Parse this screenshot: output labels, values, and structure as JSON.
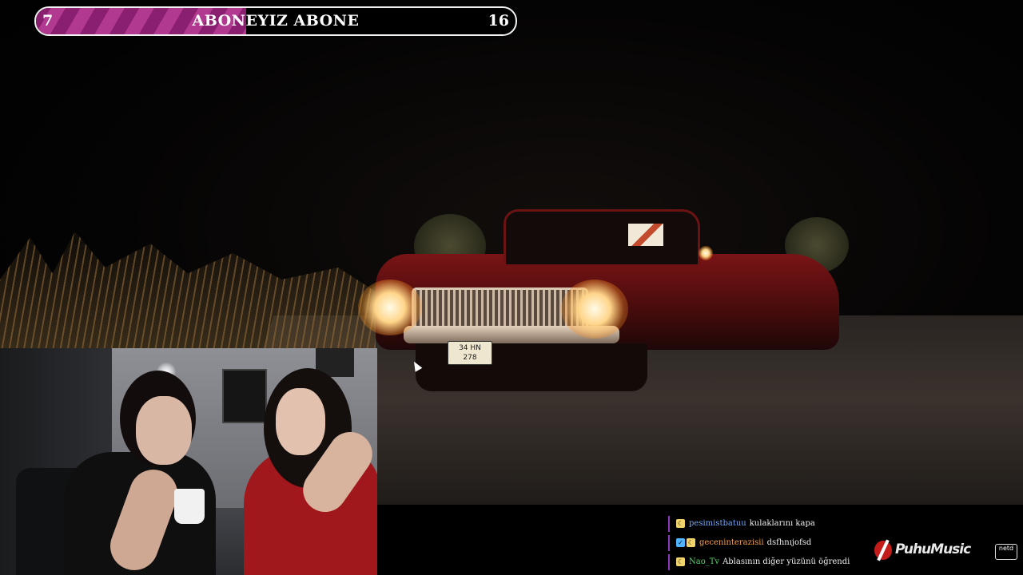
{
  "goal": {
    "current": "7",
    "title": "ABONEYIZ ABONE",
    "target": "16",
    "progress_fraction": 0.4375,
    "fill_color": "#a02f82"
  },
  "video": {
    "plate_line1": "34 HN",
    "plate_line2": "278"
  },
  "chat": {
    "messages": [
      {
        "badge": "moon-badge-icon",
        "badge_color": "#f1d36b",
        "username": "pesimistbatuu",
        "user_color": "#6fa8ff",
        "text": "kulaklarını kapa"
      },
      {
        "badge": "verified-and-moon-badge-icon",
        "badge_color": "#4fb3ff",
        "username": "geceninterazisii",
        "user_color": "#f5a04a",
        "text": "dsfhnıjofsd"
      },
      {
        "badge": "moon-badge-icon",
        "badge_color": "#f1d36b",
        "username": "Nao_Tv",
        "user_color": "#59d46b",
        "text": "Ablasının diğer yüzünü öğrendi"
      }
    ]
  },
  "branding": {
    "label_logo": "PuhuMusic",
    "netd_logo": "netd"
  }
}
